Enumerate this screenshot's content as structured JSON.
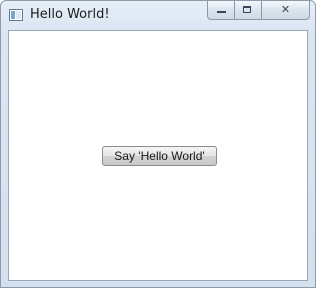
{
  "window": {
    "title": "Hello World!",
    "controls": {
      "minimize_icon": "minimize-icon",
      "maximize_icon": "maximize-icon",
      "close_icon": "close-icon",
      "close_glyph": "✕"
    }
  },
  "content": {
    "button_label": "Say 'Hello World'"
  },
  "colors": {
    "frame": "#dbe6f3",
    "client_background": "#ffffff",
    "button_gradient_top": "#f6f6f6",
    "button_gradient_bottom": "#c9c9c9"
  }
}
